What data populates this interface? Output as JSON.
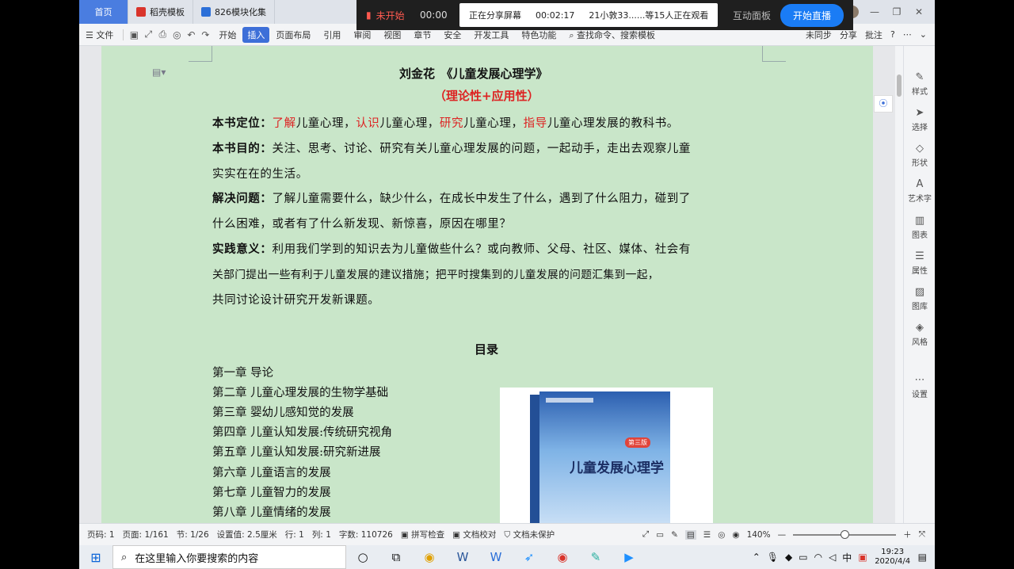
{
  "titlebar": {
    "tabs": [
      "首页",
      "稻壳模板",
      "826模块化集"
    ],
    "tab_count": "5"
  },
  "live": {
    "status": "未开始",
    "timer": "00:00",
    "sharing": "正在分享屏幕",
    "share_time": "00:02:17",
    "viewers": "21小敦33......等15人正在观看",
    "interact": "互动面板",
    "start": "开始直播"
  },
  "menubar": {
    "file": "文件",
    "items": [
      "开始",
      "插入",
      "页面布局",
      "引用",
      "审阅",
      "视图",
      "章节",
      "安全",
      "开发工具",
      "特色功能"
    ],
    "search": "查找命令、搜索模板",
    "sync": "未同步",
    "share": "分享",
    "comment": "批注"
  },
  "doc": {
    "title": "刘金花　《儿童发展心理学》",
    "subtitle": "（理论性+应用性）",
    "p1": {
      "label": "本书定位：",
      "parts": [
        "了解",
        "儿童心理，",
        "认识",
        "儿童心理，",
        "研究",
        "儿童心理，",
        "指导",
        "儿童心理发展的教科书。"
      ]
    },
    "p2": {
      "label": "本书目的：",
      "line1": "关注、思考、讨论、研究有关儿童心理发展的问题，一起动手，走出去观察儿童",
      "line2": "实实在在的生活。"
    },
    "p3": {
      "label": "解决问题：",
      "line1": "了解儿童需要什么，缺少什么，在成长中发生了什么，遇到了什么阻力，碰到了",
      "line2": "什么困难，或者有了什么新发现、新惊喜，原因在哪里？"
    },
    "p4": {
      "label": "实践意义：",
      "line1": "利用我们学到的知识去为儿童做些什么？或向教师、父母、社区、媒体、社会有",
      "line2": "关部门提出一些有利于儿童发展的建议措施；把平时搜集到的儿童发展的问题汇集到一起，",
      "line3": "共同讨论设计研究开发新课题。"
    },
    "toc_title": "目录",
    "toc": [
      "第一章  导论",
      "第二章  儿童心理发展的生物学基础",
      "第三章  婴幼儿感知觉的发展",
      "第四章  儿童认知发展:传统研究视角",
      "第五章  儿童认知发展:研究新进展",
      "第六章  儿童语言的发展",
      "第七章  儿童智力的发展",
      "第八章  儿童情绪的发展"
    ],
    "book": {
      "title": "儿童发展心理学",
      "edition": "第三版",
      "spine": "儿童发展心理学"
    }
  },
  "rpanel": [
    "样式",
    "选择",
    "形状",
    "艺术字",
    "图表",
    "属性",
    "图库",
    "风格",
    "设置"
  ],
  "status": {
    "page": "页码: 1",
    "pages": "页面: 1/161",
    "section": "节: 1/26",
    "setting": "设置值: 2.5厘米",
    "row": "行: 1",
    "col": "列: 1",
    "words": "字数: 110726",
    "spell": "拼写检查",
    "proof": "文档校对",
    "protect": "文档未保护",
    "zoom": "140%"
  },
  "taskbar": {
    "search": "在这里输入你要搜索的内容",
    "ime": "中",
    "time": "19:23",
    "date": "2020/4/4"
  },
  "colors": {
    "page_bg": "#c9e6c9",
    "accent": "#3d6fd8",
    "red": "#dd2222"
  }
}
